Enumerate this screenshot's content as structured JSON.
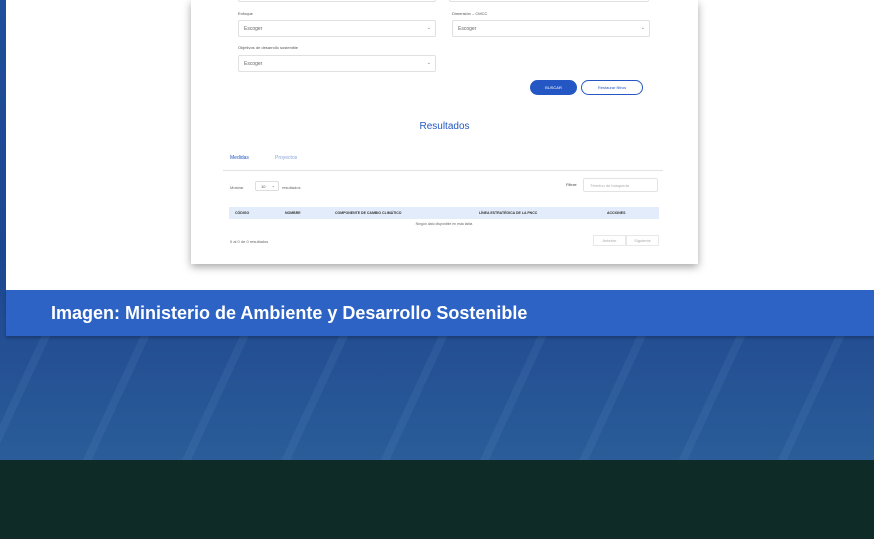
{
  "form": {
    "enfoque_label": "Enfoque",
    "enfoque_value": "Escoger",
    "dimension_label": "Dimensión – CMCC",
    "dimension_value": "Escoger",
    "ods_label": "Objetivos de desarrollo sostenible",
    "ods_value": "Escoger",
    "search_button": "BUSCAR",
    "clear_button": "Restaurar filtros"
  },
  "results": {
    "title": "Resultados",
    "tabs": [
      "Medidas",
      "Proyectos"
    ],
    "show_label": "Mostrar",
    "page_size": "10",
    "results_label": "resultados",
    "filter_label": "Filtrar:",
    "filter_placeholder": "Término de búsqueda",
    "columns": [
      "CÓDIGO",
      "NOMBRE",
      "COMPONENTE DE CAMBIO CLIMÁTICO",
      "LÍNEA ESTRATÉGICA DE LA PNCC",
      "ACCIONES"
    ],
    "empty_message": "Ningún dato disponible en esta tabla",
    "summary": "0 al 0 de 0 resultados",
    "prev": "Anterior",
    "next": "Siguiente"
  },
  "caption": "Imagen: Ministerio de Ambiente y Desarrollo Sostenible",
  "colors": {
    "accent": "#2457c4",
    "caption_bar": "#2c63c4",
    "background": "#1b4692"
  }
}
